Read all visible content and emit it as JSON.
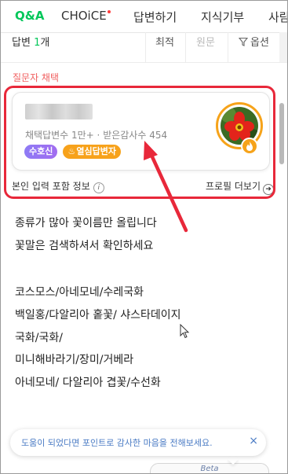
{
  "tabs": [
    {
      "label": "Q&A",
      "active": true
    },
    {
      "label": "CHOiCE",
      "has_dot": true
    },
    {
      "label": "답변하기"
    },
    {
      "label": "지식기부"
    },
    {
      "label": "사람"
    }
  ],
  "sortbar": {
    "count_prefix": "답변 ",
    "count_value": "1",
    "count_suffix": "개",
    "options": [
      "최적",
      "원문",
      "옵션"
    ]
  },
  "choice_label": "질문자 채택",
  "profile": {
    "stats": "채택답변수 1만+ · 받은감사수 454",
    "badges": [
      "수호신",
      "열심답변자"
    ],
    "avatar_icon": "red-flower-photo"
  },
  "info_row": {
    "left": "본인 입력 포함 정보",
    "right": "프로필 더보기"
  },
  "answer_lines": [
    "종류가 많아 꽃이름만 올립니다",
    "꽃말은 검색하셔서 확인하세요",
    "",
    "코스모스/아네모네/수레국화",
    "백일홍/다알리아 홑꽃/ 샤스타데이지",
    "국화/국화/",
    "미니해바라기/장미/거베라",
    "아네모네/ 다알리아 겹꽃/수선화"
  ],
  "toast": {
    "message": "도움이 되었다면 포인트로 감사한 마음을 전해보세요.",
    "close": "×"
  },
  "beta_label": "Beta",
  "colors": {
    "brand_green": "#03c75a",
    "highlight_red": "#e8283a",
    "badge_orange": "#f7a21b",
    "badge_purple": "#8e7bf5"
  }
}
